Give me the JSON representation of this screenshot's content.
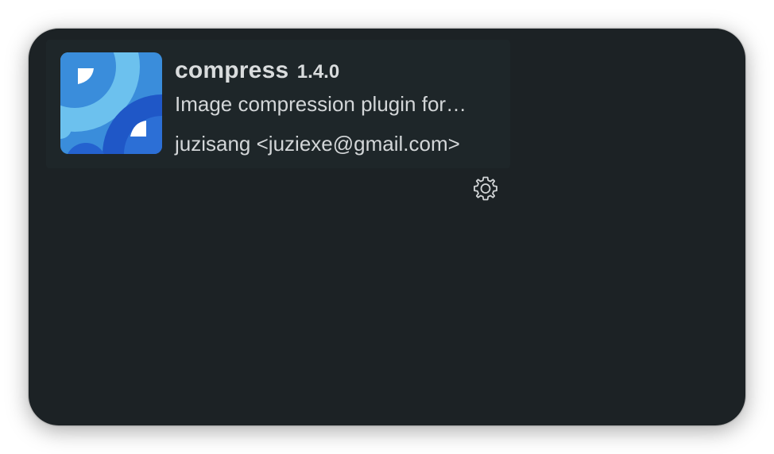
{
  "plugin": {
    "name": "compress",
    "version": "1.4.0",
    "description": "Image compression plugin for…",
    "author": "juzisang <juziexe@gmail.com>",
    "icon": "compress-logo-icon",
    "settings_icon": "gear-icon"
  },
  "colors": {
    "window_background": "#1c2225",
    "card_background": "#1e2629",
    "text": "#d3d6d8",
    "icon_light_blue": "#6cc1ee",
    "icon_mid_blue": "#3a8ddb",
    "icon_dark_blue": "#1f57c7"
  }
}
